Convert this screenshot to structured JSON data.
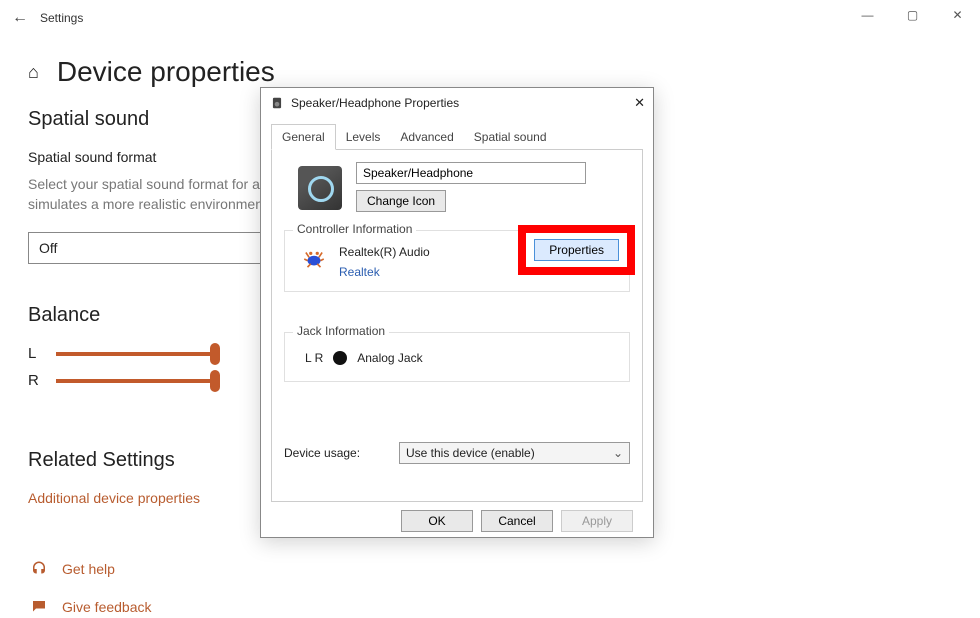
{
  "window": {
    "app_name": "Settings",
    "back_glyph": "←",
    "minimize_glyph": "—",
    "maximize_glyph": "▢",
    "close_glyph": "✕"
  },
  "page": {
    "home_glyph": "⌂",
    "title": "Device properties"
  },
  "spatial_sound": {
    "heading": "Spatial sound",
    "subheading": "Spatial sound format",
    "description": "Select your spatial sound format for an immersive audio experience that simulates a more realistic environment.",
    "selected": "Off"
  },
  "balance": {
    "heading": "Balance",
    "left_label": "L",
    "right_label": "R"
  },
  "related": {
    "heading": "Related Settings",
    "link_label": "Additional device properties"
  },
  "help": {
    "get_help": "Get help",
    "feedback": "Give feedback"
  },
  "dialog": {
    "title": "Speaker/Headphone Properties",
    "close_glyph": "✕",
    "tabs": {
      "general": "General",
      "levels": "Levels",
      "advanced": "Advanced",
      "spatial": "Spatial sound"
    },
    "device_name": "Speaker/Headphone",
    "change_icon": "Change Icon",
    "controller": {
      "legend": "Controller Information",
      "name": "Realtek(R) Audio",
      "vendor": "Realtek",
      "properties_btn": "Properties"
    },
    "jack": {
      "legend": "Jack Information",
      "channels": "L R",
      "label": "Analog Jack"
    },
    "usage": {
      "label": "Device usage:",
      "selected": "Use this device (enable)"
    },
    "buttons": {
      "ok": "OK",
      "cancel": "Cancel",
      "apply": "Apply"
    }
  }
}
